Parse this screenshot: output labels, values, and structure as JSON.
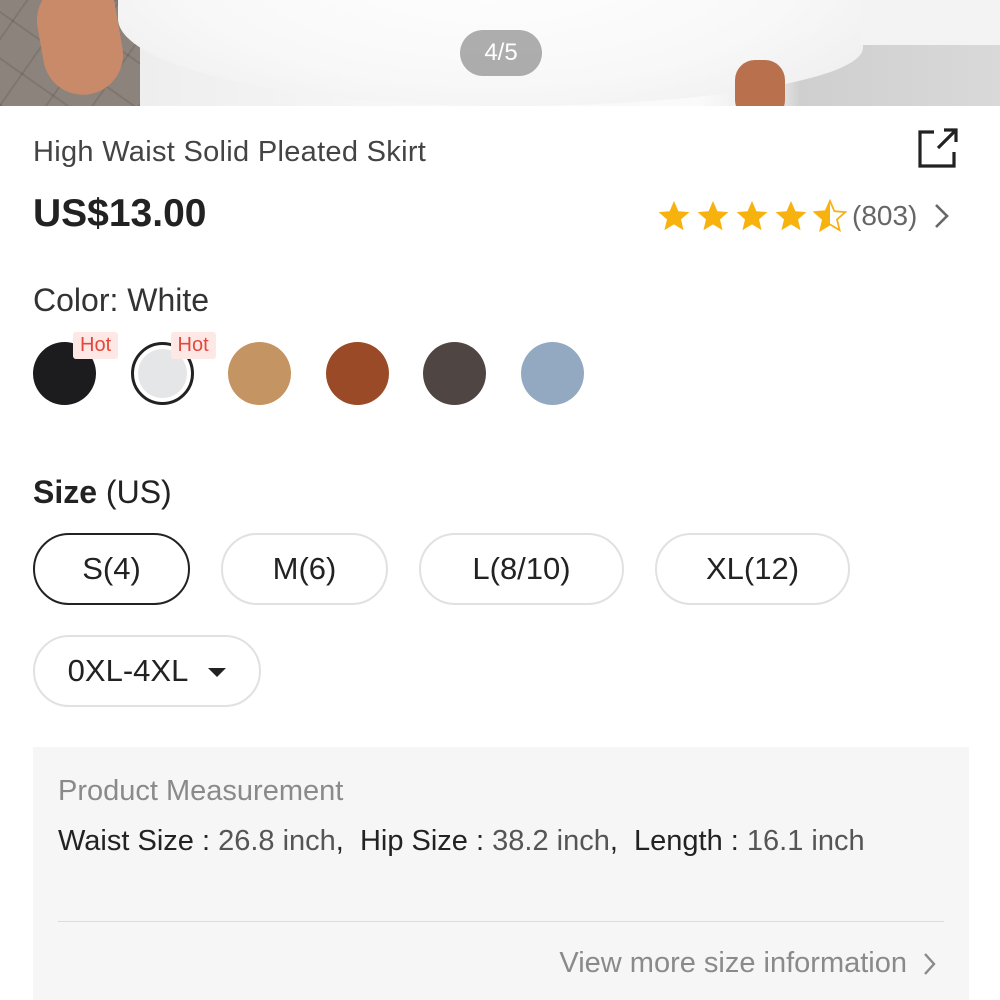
{
  "image_viewer": {
    "counter": "4/5"
  },
  "product": {
    "title": "High Waist Solid Pleated Skirt",
    "price": "US$13.00",
    "rating": 4.5,
    "rating_count": "(803)"
  },
  "color": {
    "label": "Color: White",
    "selected": "White",
    "swatches": [
      {
        "name": "Black",
        "hex": "#1c1c1e",
        "hot": "Hot"
      },
      {
        "name": "White",
        "hex": "#e4e6e8",
        "hot": "Hot"
      },
      {
        "name": "Khaki",
        "hex": "#c59463"
      },
      {
        "name": "Brown",
        "hex": "#9a4a26"
      },
      {
        "name": "Dark Grey",
        "hex": "#4f4643"
      },
      {
        "name": "Blue",
        "hex": "#93a9c1"
      }
    ]
  },
  "size": {
    "label_bold": "Size",
    "label_unit": "(US)",
    "options": [
      "S(4)",
      "M(6)",
      "L(8/10)",
      "XL(12)"
    ],
    "selected": "S(4)",
    "range_dropdown": "0XL-4XL"
  },
  "measurement": {
    "title": "Product Measurement",
    "items": [
      {
        "label": "Waist Size",
        "value": "26.8 inch"
      },
      {
        "label": "Hip Size",
        "value": "38.2 inch"
      },
      {
        "label": "Length",
        "value": "16.1 inch"
      }
    ],
    "more_link": "View more size information"
  },
  "colors": {
    "star": "#f8b20d",
    "star_empty": "#dddddd",
    "hot_bg": "#fde8e6",
    "hot_text": "#e2493c"
  }
}
